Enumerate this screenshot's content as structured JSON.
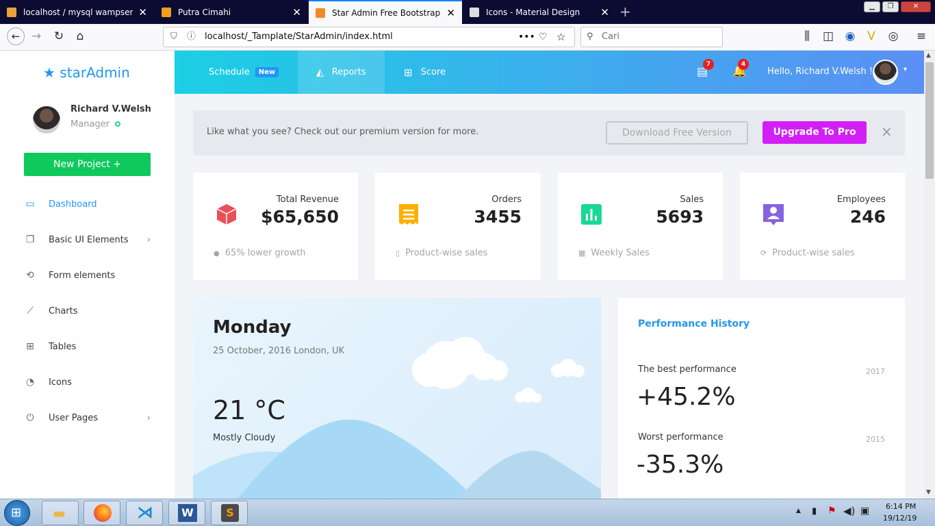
{
  "browser": {
    "tabs": [
      {
        "title": "localhost / mysql wampserver |",
        "color": "#e8a33a"
      },
      {
        "title": "Putra Cimahi",
        "color": "#f0a01e"
      },
      {
        "title": "Star Admin Free Bootstrap Adn",
        "color": "#f08a24"
      },
      {
        "title": "Icons - Material Design",
        "color": "#dddddd"
      }
    ],
    "url": "localhost/_Tamplate/StarAdmin/index.html",
    "search_placeholder": "Cari"
  },
  "brand": {
    "star": "★",
    "part1": "star",
    "part2": "Admin"
  },
  "user": {
    "name": "Richard V.Welsh",
    "role": "Manager"
  },
  "new_project": "New Project +",
  "menu": [
    {
      "label": "Dashboard",
      "icon": "monitor-icon",
      "glyph": "▭",
      "chevron": ""
    },
    {
      "label": "Basic UI Elements",
      "icon": "copy-icon",
      "glyph": "❐",
      "chevron": "›"
    },
    {
      "label": "Form elements",
      "icon": "restore-icon",
      "glyph": "⟲",
      "chevron": ""
    },
    {
      "label": "Charts",
      "icon": "chart-line-icon",
      "glyph": "⟋",
      "chevron": ""
    },
    {
      "label": "Tables",
      "icon": "table-icon",
      "glyph": "⊞",
      "chevron": ""
    },
    {
      "label": "Icons",
      "icon": "palette-icon",
      "glyph": "◔",
      "chevron": ""
    },
    {
      "label": "User Pages",
      "icon": "power-icon",
      "glyph": "⏻",
      "chevron": "›"
    }
  ],
  "navbar": {
    "schedule": "Schedule",
    "schedule_badge": "New",
    "reports": "Reports",
    "score": "Score",
    "notif_messages": "7",
    "notif_bell": "4",
    "greeting": "Hello, Richard V.Welsh !"
  },
  "banner": {
    "text": "Like what you see? Check out our premium version for more.",
    "download": "Download Free Version",
    "upgrade": "Upgrade To Pro",
    "close": "×"
  },
  "stats": [
    {
      "title": "Total Revenue",
      "value": "$65,650",
      "foot": "65% lower growth",
      "icon": "cube-icon",
      "color": "#e9505b",
      "foot_glyph": "●"
    },
    {
      "title": "Orders",
      "value": "3455",
      "foot": "Product-wise sales",
      "icon": "receipt-icon",
      "color": "#ffaf00",
      "foot_glyph": "▯"
    },
    {
      "title": "Sales",
      "value": "5693",
      "foot": "Weekly Sales",
      "icon": "poll-box-icon",
      "color": "#19d895",
      "foot_glyph": "▦"
    },
    {
      "title": "Employees",
      "value": "246",
      "foot": "Product-wise sales",
      "icon": "account-box-icon",
      "color": "#8862e0",
      "foot_glyph": "⟳"
    }
  ],
  "weather": {
    "day": "Monday",
    "date": "25 October, 2016 London, UK",
    "temp": "21 °C",
    "desc": "Mostly Cloudy"
  },
  "performance": {
    "title": "Performance History",
    "best_label": "The best performance",
    "best_year": "2017",
    "best_value": "+45.2%",
    "worst_label": "Worst performance",
    "worst_year": "2015",
    "worst_value": "-35.3%"
  },
  "taskbar": {
    "time": "6:14 PM",
    "date": "19/12/19"
  }
}
